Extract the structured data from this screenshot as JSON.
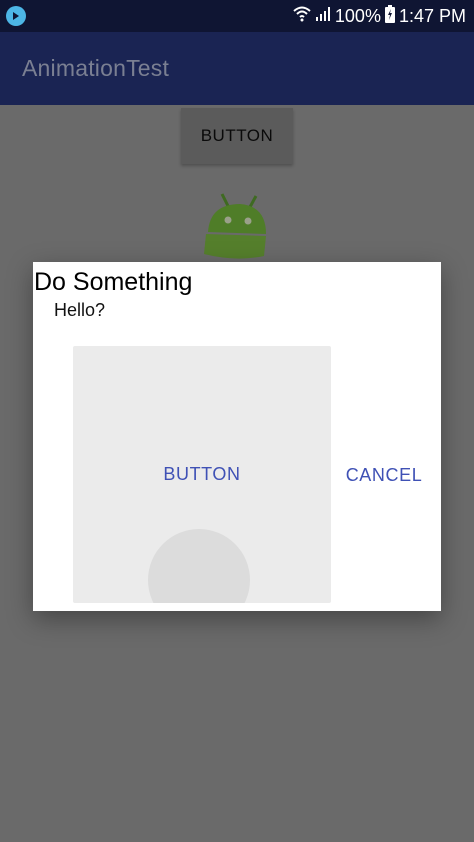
{
  "status_bar": {
    "battery": "100%",
    "time": "1:47 PM",
    "icons": [
      "app-badge-icon",
      "wifi-icon",
      "cell-signal-icon",
      "battery-charging-icon"
    ]
  },
  "app_bar": {
    "title": "AnimationTest"
  },
  "background": {
    "button_label": "BUTTON",
    "icons": [
      "android-icon"
    ]
  },
  "dialog": {
    "title": "Do Something",
    "message": "Hello?",
    "panel_button_label": "BUTTON",
    "cancel_label": "CANCEL",
    "accent_color": "#3f51b5"
  },
  "colors": {
    "status_bar": "#0f1533",
    "app_bar": "#1a2453",
    "scrim_background": "#6a6a6a",
    "android_green": "#5a8f2e"
  }
}
